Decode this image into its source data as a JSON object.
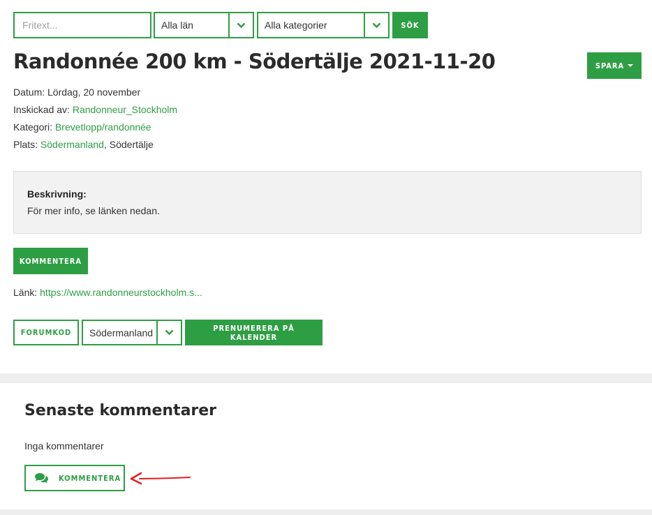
{
  "search": {
    "freetext_placeholder": "Fritext...",
    "county_select": "Alla län",
    "category_select": "Alla kategorier",
    "search_button": "SÖK"
  },
  "event": {
    "title": "Randonnée 200 km - Södertälje 2021-11-20",
    "save_button": "SPARA",
    "date_label": "Datum:",
    "date_value": "Lördag, 20 november",
    "submitted_label": "Inskickad av:",
    "submitted_by": "Randonneur_Stockholm",
    "category_label": "Kategori:",
    "category_value": "Brevetlopp/randonnée",
    "place_label": "Plats:",
    "place_region": "Södermanland",
    "place_city": ", Södertälje",
    "description_label": "Beskrivning:",
    "description_text": "För mer info, se länken nedan.",
    "comment_button": "KOMMENTERA",
    "link_label": "Länk:",
    "link_text": "https://www.randonneurstockholm.s...",
    "forum_code_button": "FORUMKOD",
    "region_select": "Södermanland",
    "subscribe_button": "PRENUMERERA PÅ KALENDER"
  },
  "comments": {
    "heading": "Senaste kommentarer",
    "empty_text": "Inga kommentarer",
    "comment_button": "KOMMENTERA",
    "icon": "comments-icon"
  },
  "colors": {
    "accent": "#2e9e44",
    "annotation_arrow": "#e02020"
  }
}
